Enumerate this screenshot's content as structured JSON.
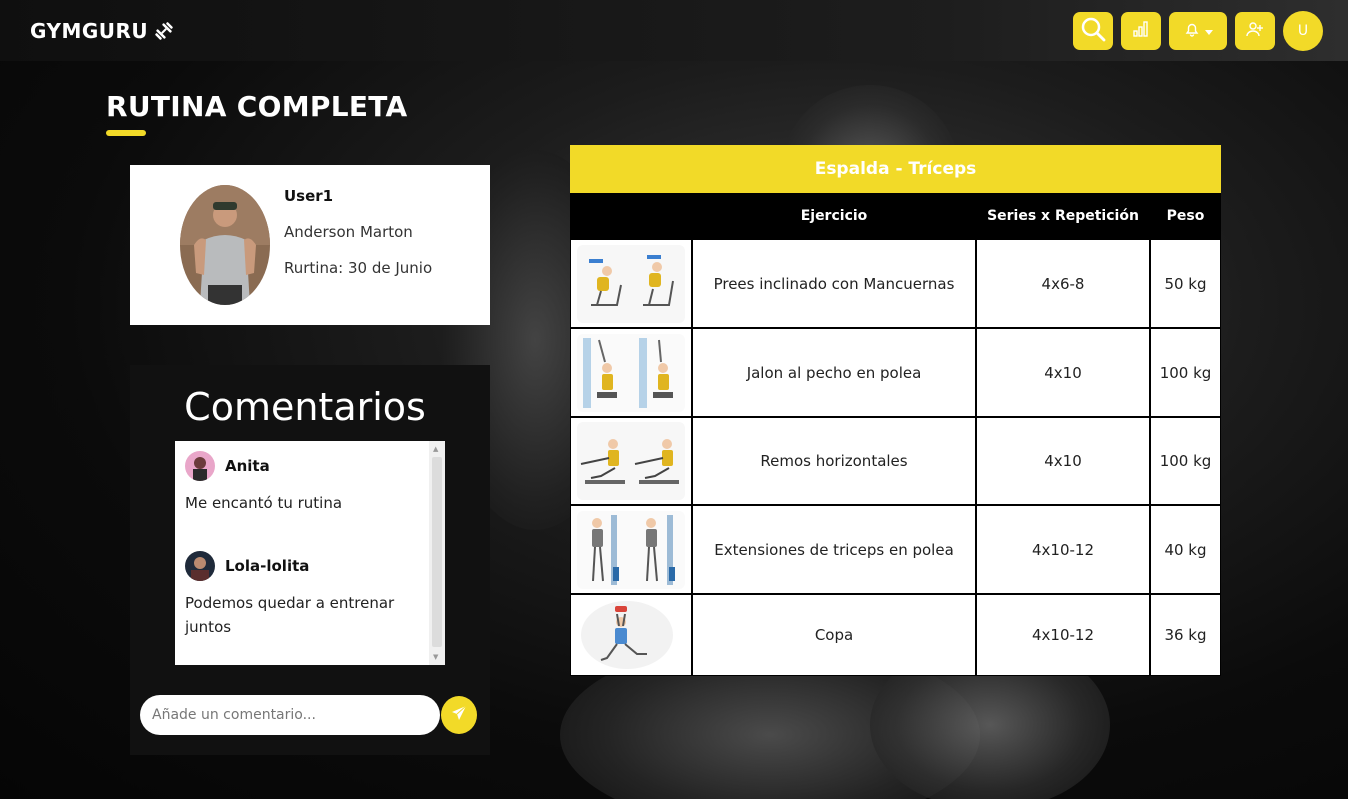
{
  "brand": {
    "name": "GYMGURU",
    "icon": "dumbbell-icon"
  },
  "nav": {
    "search_icon": "search-icon",
    "stats_icon": "bar-chart-icon",
    "notifications_icon": "bell-icon",
    "notifications_caret": "caret-down-icon",
    "add_user_icon": "user-plus-icon",
    "user_initial": "U"
  },
  "page": {
    "title": "RUTINA COMPLETA"
  },
  "profile": {
    "username": "User1",
    "full_name": "Anderson Marton",
    "routine_date": "Rurtina: 30 de Junio"
  },
  "comments": {
    "heading": "Comentarios",
    "items": [
      {
        "author": "Anita",
        "text": "Me encantó tu rutina"
      },
      {
        "author": "Lola-lolita",
        "text": "Podemos quedar a entrenar juntos"
      }
    ],
    "input_placeholder": "Añade un comentario...",
    "send_icon": "paper-plane-icon"
  },
  "routine": {
    "title": "Espalda - Tríceps",
    "columns": {
      "image": "",
      "exercise": "Ejercicio",
      "series": "Series x Repetición",
      "weight": "Peso"
    },
    "rows": [
      {
        "exercise": "Prees inclinado con Mancuernas",
        "series": "4x6-8",
        "weight": "50 kg"
      },
      {
        "exercise": "Jalon al pecho en polea",
        "series": "4x10",
        "weight": "100 kg"
      },
      {
        "exercise": "Remos horizontales",
        "series": "4x10",
        "weight": "100 kg"
      },
      {
        "exercise": "Extensiones de triceps en polea",
        "series": "4x10-12",
        "weight": "40 kg"
      },
      {
        "exercise": "Copa",
        "series": "4x10-12",
        "weight": "36 kg"
      }
    ]
  },
  "colors": {
    "accent": "#f2da28",
    "dark": "#111111"
  }
}
